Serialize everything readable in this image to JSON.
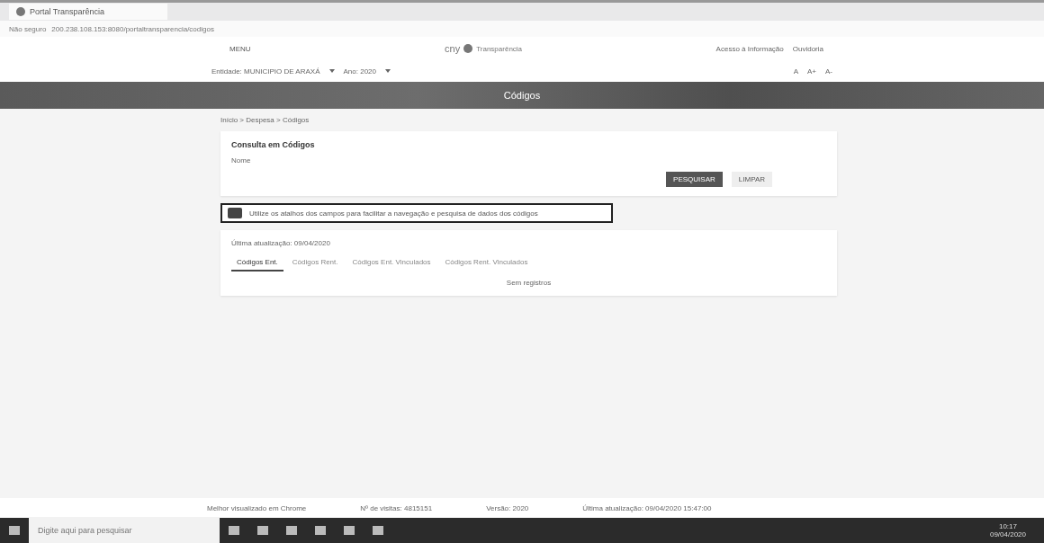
{
  "browser": {
    "tab_title": "Portal Transparência",
    "address_prefix": "Não seguro",
    "address": "200.238.108.153:8080/portaltransparencia/codigos"
  },
  "topbar": {
    "menu": "MENU",
    "logo_prefix": "cny",
    "logo_text": "Transparência",
    "links": [
      "Acesso à Informação",
      "Ouvidoria"
    ]
  },
  "context": {
    "entity": "Entidade: MUNICIPIO DE ARAXÁ",
    "year": "Ano: 2020",
    "tools": [
      "A",
      "A+",
      "A-"
    ]
  },
  "page_title": "Códigos",
  "breadcrumb": "Início > Despesa > Códigos",
  "search": {
    "title": "Consulta em Códigos",
    "field_label": "Nome",
    "buttons": [
      {
        "label": "PESQUISAR",
        "primary": true
      },
      {
        "label": "LIMPAR",
        "primary": false
      }
    ]
  },
  "notice": "Utilize os atalhos dos campos para facilitar a navegação e pesquisa de dados dos códigos",
  "results": {
    "updated": "Última atualização: 09/04/2020",
    "tabs": [
      {
        "label": "Códigos Ent.",
        "selected": true
      },
      {
        "label": "Códigos Rent.",
        "selected": false
      },
      {
        "label": "Códigos Ent. Vinculados",
        "selected": false
      },
      {
        "label": "Códigos Rent. Vinculados",
        "selected": false
      }
    ],
    "empty": "Sem registros"
  },
  "footer": [
    "Melhor visualizado em Chrome",
    "Nº de visitas: 4815151",
    "Versão: 2020",
    "Última atualização: 09/04/2020 15:47:00"
  ],
  "taskbar": {
    "search_placeholder": "Digite aqui para pesquisar",
    "time": "10:17",
    "date": "09/04/2020"
  }
}
